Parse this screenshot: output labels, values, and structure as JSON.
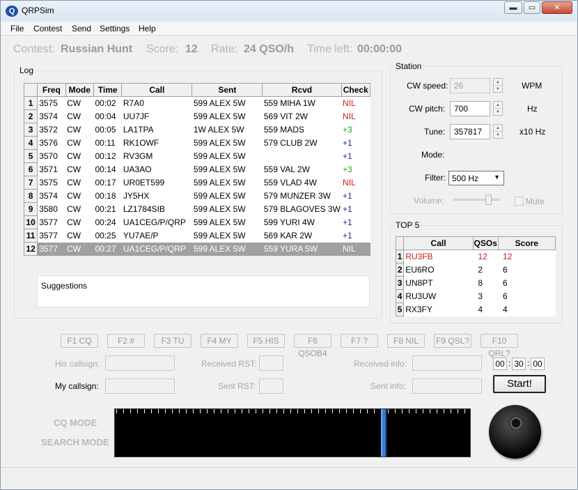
{
  "window": {
    "title": "QRPSim",
    "logo_text": "Q",
    "minimize_glyph": "▬",
    "maximize_glyph": "▭",
    "close_glyph": "✕"
  },
  "menu": [
    "File",
    "Contest",
    "Send",
    "Settings",
    "Help"
  ],
  "status": {
    "contest_label": "Contest:",
    "contest_value": "Russian Hunt",
    "score_label": "Score:",
    "score_value": "12",
    "rate_label": "Rate:",
    "rate_value": "24 QSO/h",
    "time_left_label": "Time left:",
    "time_left_value": "00:00:00"
  },
  "log": {
    "group_label": "Log",
    "columns": [
      "",
      "Freq",
      "Mode",
      "Time",
      "Call",
      "Sent",
      "Rcvd",
      "Check"
    ],
    "rows": [
      {
        "n": "1",
        "freq": "3575",
        "mode": "CW",
        "time": "00:02",
        "call": "R7A0",
        "sent": "599 ALEX 5W",
        "rcvd": "559 MIHA 1W",
        "check": "NIL"
      },
      {
        "n": "2",
        "freq": "3574",
        "mode": "CW",
        "time": "00:04",
        "call": "UU7JF",
        "sent": "599 ALEX 5W",
        "rcvd": "569 VIT 2W",
        "check": "NIL"
      },
      {
        "n": "3",
        "freq": "3572",
        "mode": "CW",
        "time": "00:05",
        "call": "LA1TPA",
        "sent": "1W ALEX 5W",
        "rcvd": "559 MADS",
        "check": "+3"
      },
      {
        "n": "4",
        "freq": "3576",
        "mode": "CW",
        "time": "00:11",
        "call": "RK1OWF",
        "sent": "599 ALEX 5W",
        "rcvd": "579 CLUB 2W",
        "check": "+1"
      },
      {
        "n": "5",
        "freq": "3570",
        "mode": "CW",
        "time": "00:12",
        "call": "RV3GM",
        "sent": "599 ALEX 5W",
        "rcvd": "",
        "check": "+1"
      },
      {
        "n": "6",
        "freq": "3571",
        "mode": "CW",
        "time": "00:14",
        "call": "UA3AO",
        "sent": "599 ALEX 5W",
        "rcvd": "559 VAL 2W",
        "check": "+3"
      },
      {
        "n": "7",
        "freq": "3575",
        "mode": "CW",
        "time": "00:17",
        "call": "UR0ET599",
        "sent": "599 ALEX 5W",
        "rcvd": "559 VLAD 4W",
        "check": "NIL"
      },
      {
        "n": "8",
        "freq": "3574",
        "mode": "CW",
        "time": "00:18",
        "call": "JY5HX",
        "sent": "599 ALEX 5W",
        "rcvd": "579 MUNZER 3W",
        "check": "+1"
      },
      {
        "n": "9",
        "freq": "3580",
        "mode": "CW",
        "time": "00:21",
        "call": "LZ1784SIB",
        "sent": "599 ALEX 5W",
        "rcvd": "579 BLAGOVES 3W",
        "check": "+1"
      },
      {
        "n": "10",
        "freq": "3577",
        "mode": "CW",
        "time": "00:24",
        "call": "UA1CEG/P/QRP",
        "sent": "599 ALEX 5W",
        "rcvd": "599 YURI 4W",
        "check": "+1"
      },
      {
        "n": "11",
        "freq": "3577",
        "mode": "CW",
        "time": "00:25",
        "call": "YU7AE/P",
        "sent": "599 ALEX 5W",
        "rcvd": "569 KAR 2W",
        "check": "+1"
      },
      {
        "n": "12",
        "freq": "3577",
        "mode": "CW",
        "time": "00:27",
        "call": "UA1CEG/P/QRP",
        "sent": "599 ALEX 5W",
        "rcvd": "559 YURA 5W",
        "check": "NIL"
      }
    ],
    "suggestions_label": "Suggestions"
  },
  "station": {
    "group_label": "Station",
    "cw_speed_label": "CW speed:",
    "cw_speed_value": "26",
    "cw_speed_unit": "WPM",
    "cw_pitch_label": "CW pitch:",
    "cw_pitch_value": "700",
    "cw_pitch_unit": "Hz",
    "tune_label": "Tune:",
    "tune_value": "357817",
    "tune_unit": "x10 Hz",
    "mode_label": "Mode:",
    "filter_label": "Filter:",
    "filter_value": "500 Hz",
    "volume_label": "Volume:",
    "volume_level": 0.75,
    "mute_label": "Mute"
  },
  "top5": {
    "group_label": "TOP 5",
    "columns": [
      "",
      "Call",
      "QSOs",
      "Score"
    ],
    "rows": [
      {
        "n": "1",
        "call": "RU3FB",
        "qsos": "12",
        "score": "12",
        "highlight": true
      },
      {
        "n": "2",
        "call": "EU6RO",
        "qsos": "2",
        "score": "6",
        "highlight": false
      },
      {
        "n": "3",
        "call": "UN8PT",
        "qsos": "8",
        "score": "6",
        "highlight": false
      },
      {
        "n": "4",
        "call": "RU3UW",
        "qsos": "3",
        "score": "6",
        "highlight": false
      },
      {
        "n": "5",
        "call": "RX3FY",
        "qsos": "4",
        "score": "4",
        "highlight": false
      }
    ]
  },
  "fkeys": [
    "F1 CQ",
    "F2 #",
    "F3 TU",
    "F4 MY",
    "F5 HIS",
    "F6 QSOB4",
    "F7 ?",
    "F8 NIL",
    "F9 QSL?",
    "F10 QRL?"
  ],
  "entry": {
    "his_callsign_label": "His callsign:",
    "my_callsign_label": "My callsign:",
    "received_rst_label": "Received RST:",
    "sent_rst_label": "Sent RST:",
    "received_info_label": "Received info:",
    "sent_info_label": "Sent info:",
    "timer_hh": "00",
    "timer_mm": "30",
    "timer_ss": "00",
    "timer_sep": ":",
    "start_label": "Start!"
  },
  "modes": {
    "cq_mode": "CQ MODE",
    "search_mode": "SEARCH MODE"
  },
  "icons": {
    "app": "qrpsim-logo-icon",
    "knob": "tuning-knob-icon"
  },
  "colors": {
    "nil": "#c81e1e",
    "plus1": "#1d2a9f",
    "plus3": "#2a9d2a",
    "selection": "#a0a0a0",
    "waterfall_cursor": "#3c7fd6"
  }
}
